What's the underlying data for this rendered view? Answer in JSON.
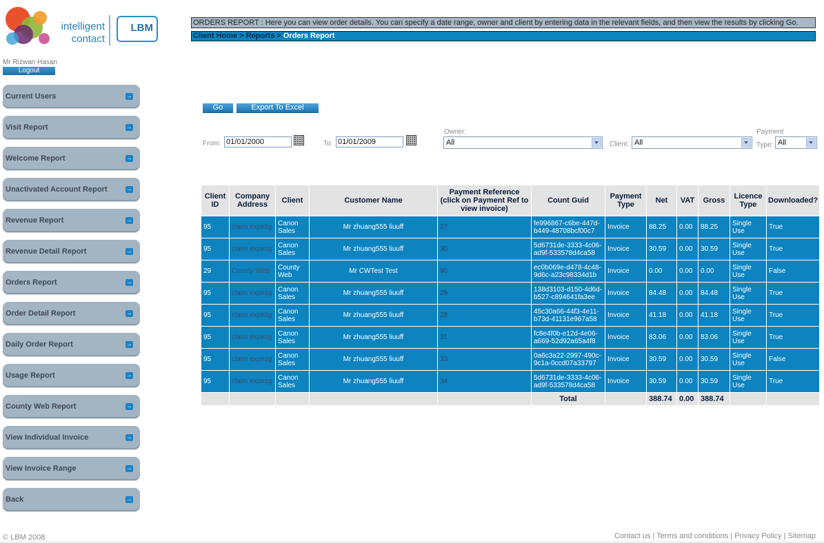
{
  "brand": {
    "tagline_line1": "intelligent",
    "tagline_line2": "contact",
    "company": "LBM"
  },
  "user": {
    "name": "Mr Rizwan Hasan",
    "logout_label": "Logout"
  },
  "sidebar": {
    "items": [
      {
        "label": "Current Users"
      },
      {
        "label": "Visit Report"
      },
      {
        "label": "Welcome Report"
      },
      {
        "label": "Unactivated Account Report"
      },
      {
        "label": "Revenue Report"
      },
      {
        "label": "Revenue Detail Report"
      },
      {
        "label": "Orders Report"
      },
      {
        "label": "Order Detail Report"
      },
      {
        "label": "Daily Order Report"
      },
      {
        "label": "Usage Report"
      },
      {
        "label": "County Web Report"
      },
      {
        "label": "View Individual Invoice"
      },
      {
        "label": "View Invoice Range"
      },
      {
        "label": "Back"
      }
    ]
  },
  "header": {
    "info": "ORDERS REPORT : Here you can view order details. You can specify a date range, owner and client by entering data in the relevant fields, and then view the results by clicking Go.",
    "breadcrumb": {
      "home": "Client Home",
      "sep": ">",
      "reports": "Reports",
      "current": "Orders Report"
    }
  },
  "actions": {
    "go_label": "Go",
    "export_label": "Export To Excel"
  },
  "filters": {
    "from_label": "From:",
    "from_value": "01/01/2000",
    "to_label": "To:",
    "to_value": "01/01/2009",
    "owner_label": "Owner:",
    "owner_value": "All",
    "client_label": "Client:",
    "client_value": "All",
    "payment_label_line1": "Payment",
    "payment_label_line2": "Type:",
    "payment_value": "All"
  },
  "table": {
    "headers": [
      "Client ID",
      "Company Address",
      "Client",
      "Customer Name",
      "Payment Reference (click on Payment Ref to view invoice)",
      "Count Guid",
      "Payment Type",
      "Net",
      "VAT",
      "Gross",
      "Licence Type",
      "Downloaded?"
    ],
    "rows": [
      [
        "95",
        "claim expezg",
        "Canon Sales",
        "Mr  zhuang555   liuuff",
        "27",
        "fe996867-c6be-447d-b449-48708bcf00c7",
        "Invoice",
        "88.25",
        "0.00",
        "88.25",
        "Single Use",
        "True"
      ],
      [
        "95",
        "claim expezg",
        "Canon Sales",
        "Mr  zhuang555   liuuff",
        "30",
        "5d6731de-3333-4c06-ad9f-533578d4ca58",
        "Invoice",
        "30.59",
        "0.00",
        "30.59",
        "Single Use",
        "True"
      ],
      [
        "29",
        "County Web",
        "County Web",
        "Mr  CWTest   Test",
        "90",
        "ec0b069e-d478-4c48-9d6c-a23c98334d1b",
        "Invoice",
        "0.00",
        "0.00",
        "0.00",
        "Single Use",
        "False"
      ],
      [
        "95",
        "claim expezg",
        "Canon Sales",
        "Mr  zhuang555   liuuff",
        "29",
        "138d3103-d150-4d6d-b527-c894641fa3ee",
        "Invoice",
        "84.48",
        "0.00",
        "84.48",
        "Single Use",
        "True"
      ],
      [
        "95",
        "claim expezg",
        "Canon Sales",
        "Mr  zhuang555   liuuff",
        "28",
        "45c30a66-44f3-4e11-b73d-41131e967a58",
        "Invoice",
        "41.18",
        "0.00",
        "41.18",
        "Single Use",
        "True"
      ],
      [
        "95",
        "claim expezg",
        "Canon Sales",
        "Mr  zhuang555   liuuff",
        "31",
        "fc8e4f0b-e12d-4e06-a669-52d92a65a4f8",
        "Invoice",
        "83.06",
        "0.00",
        "83.06",
        "Single Use",
        "True"
      ],
      [
        "95",
        "claim expezg",
        "Canon Sales",
        "Mr  zhuang555   liuuff",
        "33",
        "0a6c3a22-2997-490c-9c1a-0ccd07a33797",
        "Invoice",
        "30.59",
        "0.00",
        "30.59",
        "Single Use",
        "False"
      ],
      [
        "95",
        "claim expezg",
        "Canon Sales",
        "Mr  zhuang555   liuuff",
        "34",
        "5d6731de-3333-4c06-ad9f-533578d4ca58",
        "Invoice",
        "30.59",
        "0.00",
        "30.59",
        "Single Use",
        "True"
      ]
    ],
    "footer": {
      "total_label": "Total",
      "net": "388.74",
      "vat": "0.00",
      "gross": "388.74"
    }
  },
  "footer": {
    "copyright": "© LBM 2008",
    "links": [
      "Contact us",
      "Terms and conditions",
      "Privacy Policy",
      "Sitemap"
    ]
  },
  "colors": {
    "accent": "#0d83c0",
    "nav_button": "#a3b4c2",
    "info_bar": "#a9b8c9"
  }
}
